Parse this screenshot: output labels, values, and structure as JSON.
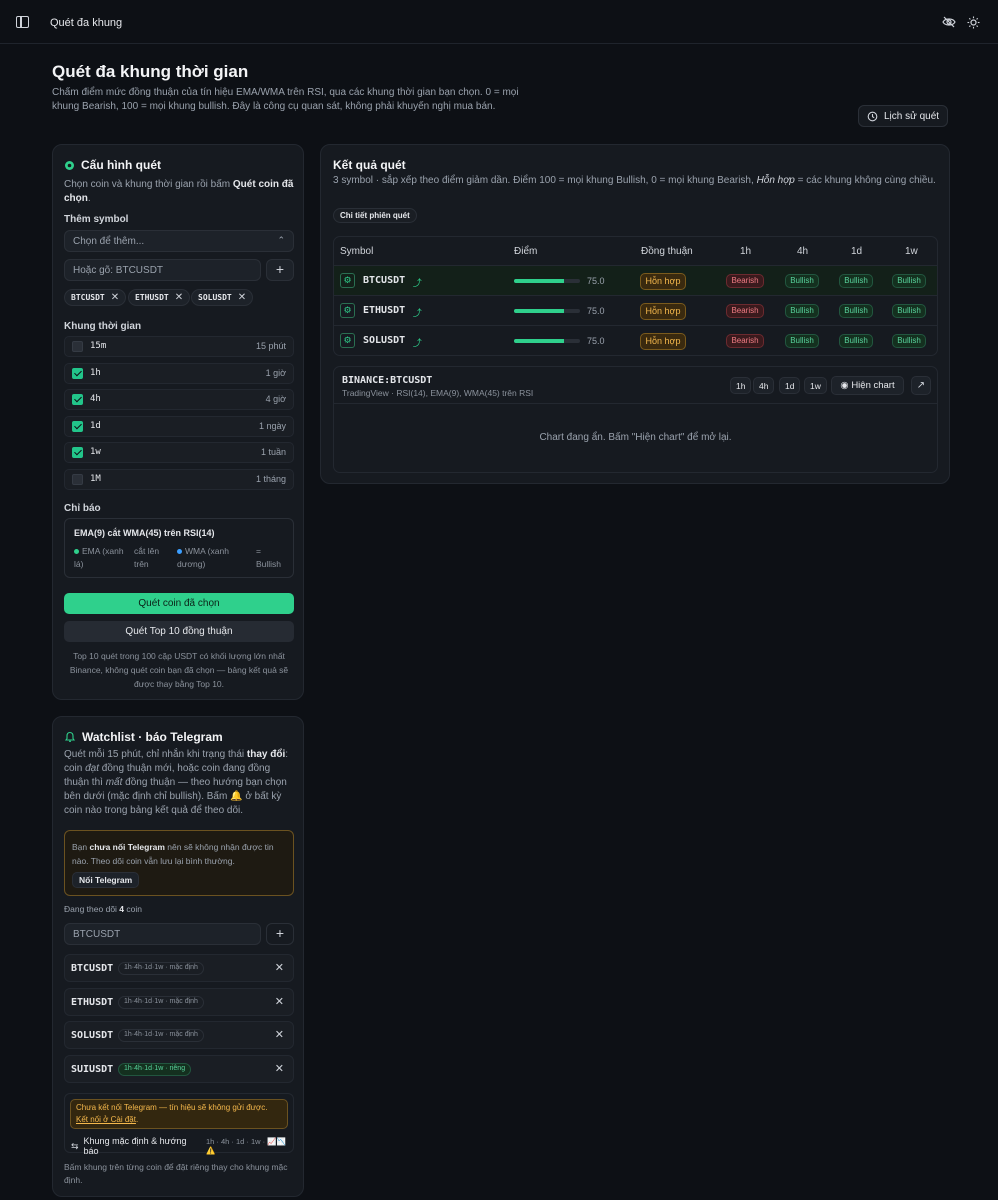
{
  "topbar": {
    "title": "Quét đa khung",
    "icons": [
      "sidebar-toggle-icon",
      "eye-off-icon",
      "sun-icon"
    ]
  },
  "header": {
    "title": "Quét đa khung thời gian",
    "description": "Chấm điểm mức đồng thuận của tín hiệu EMA/WMA trên RSI, qua các khung thời gian bạn chọn. 0 = mọi khung Bearish, 100 = mọi khung bullish. Đây là công cụ quan sát, không phải khuyến nghị mua bán.",
    "history_button": "Lịch sử quét"
  },
  "config": {
    "title": "Cấu hình quét",
    "subtitle_pre": "Chọn coin và khung thời gian rồi bấm ",
    "subtitle_bold": "Quét coin đã chọn",
    "subtitle_post": ".",
    "add_symbol_label": "Thêm symbol",
    "select_placeholder": "Chọn để thêm...",
    "input_placeholder": "Hoặc gõ: BTCUSDT",
    "chips": [
      "BTCUSDT",
      "ETHUSDT",
      "SOLUSDT"
    ],
    "timeframe_label": "Khung thời gian",
    "timeframes": [
      {
        "code": "15m",
        "name": "15 phút",
        "checked": false
      },
      {
        "code": "1h",
        "name": "1 giờ",
        "checked": true
      },
      {
        "code": "4h",
        "name": "4 giờ",
        "checked": true
      },
      {
        "code": "1d",
        "name": "1 ngày",
        "checked": true
      },
      {
        "code": "1w",
        "name": "1 tuần",
        "checked": true
      },
      {
        "code": "1M",
        "name": "1 tháng",
        "checked": false
      }
    ],
    "indicator_label": "Chỉ báo",
    "indicator_title": "EMA(9) cắt WMA(45) trên RSI(14)",
    "legend": {
      "ema": "EMA (xanh lá)",
      "cross": "cắt lên trên",
      "wma": "WMA (xanh dương)",
      "result": "= Bullish"
    },
    "scan_selected": "Quét coin đã chọn",
    "scan_top10": "Quét Top 10 đồng thuận",
    "footnote": "Top 10 quét trong 100 cặp USDT có khối lượng lớn nhất Binance, không quét coin bạn đã chọn — bảng kết quả sẽ được thay bằng Top 10.",
    "colors": {
      "ema": "#2fd08c",
      "wma": "#3b9eff"
    }
  },
  "results": {
    "title": "Kết quả quét",
    "subtitle_pre": "3 symbol · sắp xếp theo điểm giảm dần. Điểm 100 = mọi khung Bullish, 0 = mọi khung Bearish, ",
    "subtitle_em": "Hỗn hợp",
    "subtitle_post": " = các khung không cùng chiều.",
    "details_button": "Chi tiết phiên quét",
    "columns": [
      "Symbol",
      "Điểm",
      "Đồng thuận",
      "1h",
      "4h",
      "1d",
      "1w"
    ],
    "rows": [
      {
        "symbol": "BTCUSDT",
        "score": "75.0",
        "score_pct": 0.75,
        "consensus": "Hỗn hợp",
        "tf": [
          "Bearish",
          "Bullish",
          "Bullish",
          "Bullish"
        ]
      },
      {
        "symbol": "ETHUSDT",
        "score": "75.0",
        "score_pct": 0.75,
        "consensus": "Hỗn hợp",
        "tf": [
          "Bearish",
          "Bullish",
          "Bullish",
          "Bullish"
        ]
      },
      {
        "symbol": "SOLUSDT",
        "score": "75.0",
        "score_pct": 0.75,
        "consensus": "Hỗn hợp",
        "tf": [
          "Bearish",
          "Bullish",
          "Bullish",
          "Bullish"
        ]
      }
    ],
    "chart": {
      "symbol": "BINANCE:BTCUSDT",
      "meta": "TradingView · RSI(14), EMA(9), WMA(45) trên RSI",
      "tf_buttons": [
        "1h",
        "4h",
        "1d",
        "1w"
      ],
      "show_button": "Hiện chart",
      "empty_text": "Chart đang ẩn. Bấm \"Hiện chart\" để mở lại."
    }
  },
  "watchlist": {
    "title": "Watchlist · báo Telegram",
    "desc_1": "Quét mỗi 15 phút, chỉ nhắn khi trạng thái ",
    "desc_b": "thay đổi",
    "desc_2": ": coin ",
    "desc_i1": "đạt",
    "desc_3": " đồng thuận mới, hoặc coin đang đồng thuận thì ",
    "desc_i2": "mất",
    "desc_4": " đồng thuận — theo hướng bạn chọn bên dưới (mặc định chỉ bullish). Bấm 🔔 ở bất kỳ coin nào trong bảng kết quả để theo dõi.",
    "warn_pre": "Bạn ",
    "warn_b": "chưa nối Telegram",
    "warn_post": " nên sẽ không nhận được tin nào. Theo dõi coin vẫn lưu lại bình thường.",
    "connect_button": "Nối Telegram",
    "following_pre": "Đang theo dõi ",
    "following_count": "4",
    "following_post": " coin",
    "input_placeholder": "BTCUSDT",
    "items": [
      {
        "symbol": "BTCUSDT",
        "tag": "1h·4h·1d·1w · mặc định",
        "custom": false
      },
      {
        "symbol": "ETHUSDT",
        "tag": "1h·4h·1d·1w · mặc định",
        "custom": false
      },
      {
        "symbol": "SOLUSDT",
        "tag": "1h·4h·1d·1w · mặc định",
        "custom": false
      },
      {
        "symbol": "SUIUSDT",
        "tag": "1h·4h·1d·1w · riêng",
        "custom": true
      }
    ],
    "tg_warning": "Chưa kết nối Telegram — tín hiệu sẽ không gửi được.",
    "tg_link": "Kết nối ở Cài đặt",
    "default_label": "Khung mặc định & hướng báo",
    "default_value": "1h · 4h · 1d · 1w · 📈📉⚠️",
    "footnote": "Bấm khung trên từng coin để đặt riêng thay cho khung mặc định."
  }
}
